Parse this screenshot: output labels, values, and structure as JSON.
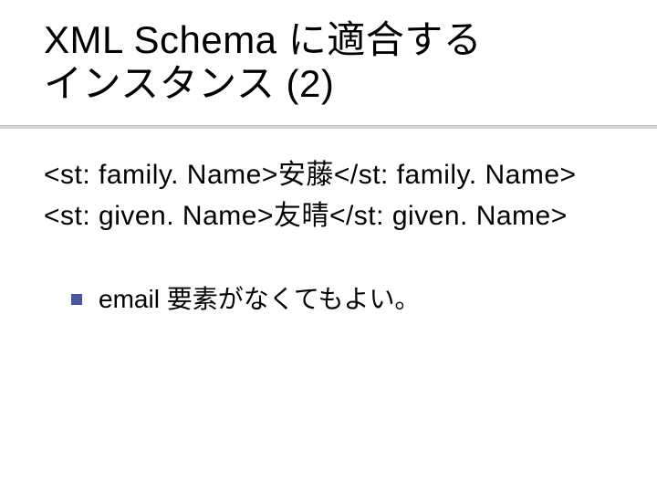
{
  "title_line1": "XML Schema に適合する",
  "title_line2": "インスタンス (2)",
  "code": {
    "line1": "<st: family. Name>安藤</st: family. Name>",
    "line2": "<st: given. Name>友晴</st: given. Name>"
  },
  "bullets": [
    "email 要素がなくてもよい。"
  ]
}
